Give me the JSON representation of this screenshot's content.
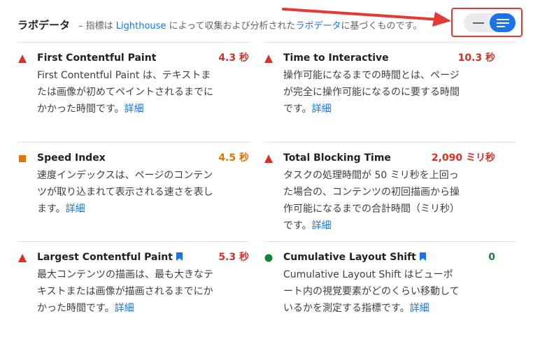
{
  "header": {
    "title": "ラボデータ",
    "desc_prefix": "– 指標は ",
    "desc_link": "Lighthouse",
    "desc_middle": " によって収集および分析された",
    "desc_link2": "ラボデータ",
    "desc_suffix": "に基づくものです。"
  },
  "view_toggle": {
    "left_icon": "collapsed-view-icon",
    "right_icon": "expanded-view-icon",
    "selected": "expanded"
  },
  "metrics": [
    {
      "name": "First Contentful Paint",
      "value": "4.3 秒",
      "status": "fail",
      "color": "#d93025",
      "bookmark": false,
      "description": "First Contentful Paint は、テキストまたは画像が初めてペイントされるまでにかかった時間です。",
      "link": "詳細"
    },
    {
      "name": "Time to Interactive",
      "value": "10.3 秒",
      "status": "fail",
      "color": "#d93025",
      "bookmark": false,
      "description": "操作可能になるまでの時間とは、ページが完全に操作可能になるのに要する時間です。",
      "link": "詳細"
    },
    {
      "name": "Speed Index",
      "value": "4.5 秒",
      "status": "average",
      "color": "#e37400",
      "bookmark": false,
      "description": "速度インデックスは、ページのコンテンツが取り込まれて表示される速さを表します。",
      "link": "詳細"
    },
    {
      "name": "Total Blocking Time",
      "value": "2,090 ミリ秒",
      "status": "fail",
      "color": "#d93025",
      "bookmark": false,
      "description": "タスクの処理時間が 50 ミリ秒を上回った場合の、コンテンツの初回描画から操作可能になるまでの合計時間（ミリ秒）です。",
      "link": "詳細"
    },
    {
      "name": "Largest Contentful Paint",
      "value": "5.3 秒",
      "status": "fail",
      "color": "#d93025",
      "bookmark": true,
      "description": "最大コンテンツの描画は、最も大きなテキストまたは画像が描画されるまでにかかった時間です。",
      "link": "詳細"
    },
    {
      "name": "Cumulative Layout Shift",
      "value": "0",
      "status": "pass",
      "color": "#188038",
      "bookmark": true,
      "description": "Cumulative Layout Shift はビューポート内の視覚要素がどのくらい移動しているかを測定する指標です。",
      "link": "詳細"
    }
  ]
}
